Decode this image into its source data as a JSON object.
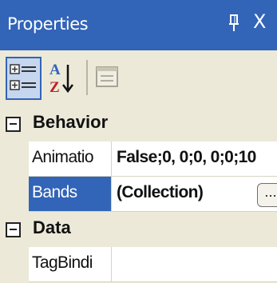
{
  "panel": {
    "title": "Properties",
    "pin_icon": "pin-icon",
    "close_glyph": "X"
  },
  "toolbar": {
    "buttons": [
      {
        "name": "categorized-button",
        "icon": "categorized-icon",
        "active": true
      },
      {
        "name": "alphabetical-button",
        "icon": "sort-az-icon",
        "glyph_top": "A",
        "glyph_bottom": "Z"
      },
      {
        "name": "property-pages-button",
        "icon": "property-pages-icon",
        "disabled": true
      }
    ]
  },
  "grid": {
    "categories": [
      {
        "label": "Behavior",
        "expanded": true,
        "properties": [
          {
            "name": "Animatio",
            "value": "False;0, 0;0, 0;0;10"
          },
          {
            "name": "Bands",
            "value": "(Collection)",
            "selected": true,
            "has_ellipsis": true,
            "ellipsis": "..."
          }
        ]
      },
      {
        "label": "Data",
        "expanded": true,
        "properties": [
          {
            "name": "TagBindi",
            "value": ""
          }
        ]
      }
    ]
  },
  "colors": {
    "title_bar": "#3264b8",
    "selection": "#3264b8",
    "toolbar_bg": "#ece9d8"
  }
}
